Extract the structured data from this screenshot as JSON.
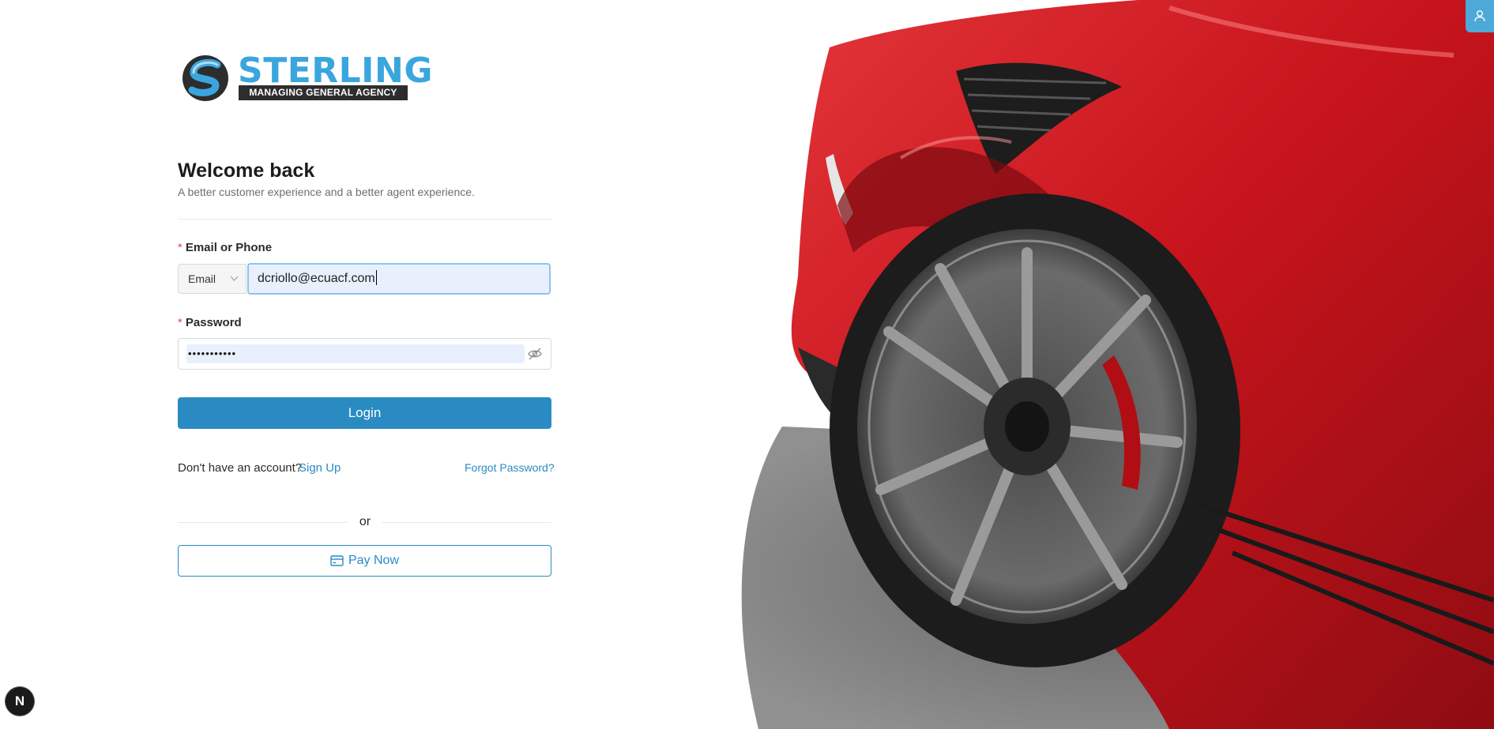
{
  "brand": {
    "name": "STERLING",
    "tagline": "MANAGING GENERAL AGENCY",
    "primary_color": "#3aa6de",
    "dark_color": "#2d2d2d"
  },
  "welcome": {
    "title": "Welcome back",
    "subtitle": "A better customer experience and a better agent experience."
  },
  "form": {
    "email_label": "Email or Phone",
    "email_type_selected": "Email",
    "email_value": "dcriollo@ecuacf.com",
    "password_label": "Password",
    "password_masked": "•••••••••••",
    "required_mark": "*",
    "login_label": "Login"
  },
  "links": {
    "no_account_text": "Don't have an account?",
    "signup_label": "Sign Up",
    "forgot_label": "Forgot Password?"
  },
  "separator_text": "or",
  "pay_now_label": "Pay Now",
  "dev_badge_letter": "N",
  "icons": {
    "eye": "eye-off-icon",
    "card": "credit-card-icon",
    "user": "user-icon",
    "chevron": "chevron-down-icon"
  },
  "colors": {
    "accent": "#2a8bc2",
    "required": "#e5484d",
    "autofill_bg": "#e8f0fe",
    "car_red": "#c8141c"
  }
}
